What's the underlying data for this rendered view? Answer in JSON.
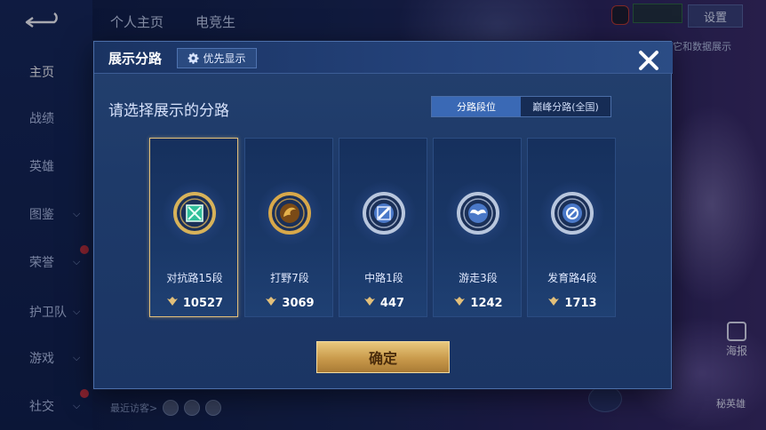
{
  "background": {
    "nav_items": [
      {
        "label": "主页",
        "active": true,
        "chevron": false,
        "dot": false
      },
      {
        "label": "战绩",
        "active": false,
        "chevron": false,
        "dot": false
      },
      {
        "label": "英雄",
        "active": false,
        "chevron": false,
        "dot": false
      },
      {
        "label": "图鉴",
        "active": false,
        "chevron": true,
        "dot": false
      },
      {
        "label": "荣誉",
        "active": false,
        "chevron": true,
        "dot": true
      },
      {
        "label": "护卫队",
        "active": false,
        "chevron": true,
        "dot": false
      },
      {
        "label": "游戏",
        "active": false,
        "chevron": true,
        "dot": false
      },
      {
        "label": "社交",
        "active": false,
        "chevron": true,
        "dot": true
      }
    ],
    "top_tabs": [
      "个人主页",
      "电竞生"
    ],
    "settings_label": "设置",
    "note_text": "它和数据展示",
    "visitors_label": "最近访客>",
    "report_label": "海报",
    "hero_btn_label": "秘英雄"
  },
  "modal": {
    "title": "展示分路",
    "priority_label": "优先显示",
    "subtitle": "请选择展示的分路",
    "segments": {
      "rank": "分路段位",
      "peak": "巅峰分路(全国)"
    },
    "confirm_label": "确定",
    "cards": [
      {
        "lane": "对抗路15段",
        "score": "10527",
        "selected": true,
        "icon": "clash-lane-emblem-icon",
        "colors": {
          "rim": "#d7b25a",
          "core": "#2fbf9a"
        }
      },
      {
        "lane": "打野7段",
        "score": "3069",
        "selected": false,
        "icon": "jungle-dragon-emblem-icon",
        "colors": {
          "rim": "#d8a84a",
          "core": "#e5b24c"
        }
      },
      {
        "lane": "中路1段",
        "score": "447",
        "selected": false,
        "icon": "mid-lane-emblem-icon",
        "colors": {
          "rim": "#b8c6dd",
          "core": "#4a78c8"
        }
      },
      {
        "lane": "游走3段",
        "score": "1242",
        "selected": false,
        "icon": "roam-wings-emblem-icon",
        "colors": {
          "rim": "#b8c6dd",
          "core": "#4a78c8"
        }
      },
      {
        "lane": "发育路4段",
        "score": "1713",
        "selected": false,
        "icon": "farm-lane-emblem-icon",
        "colors": {
          "rim": "#b8c6dd",
          "core": "#4a78c8"
        }
      }
    ]
  },
  "colors": {
    "accent_gold": "#e2bf7a",
    "segment_active": "#3a69b5",
    "modal_bg": "#1e3a69"
  }
}
